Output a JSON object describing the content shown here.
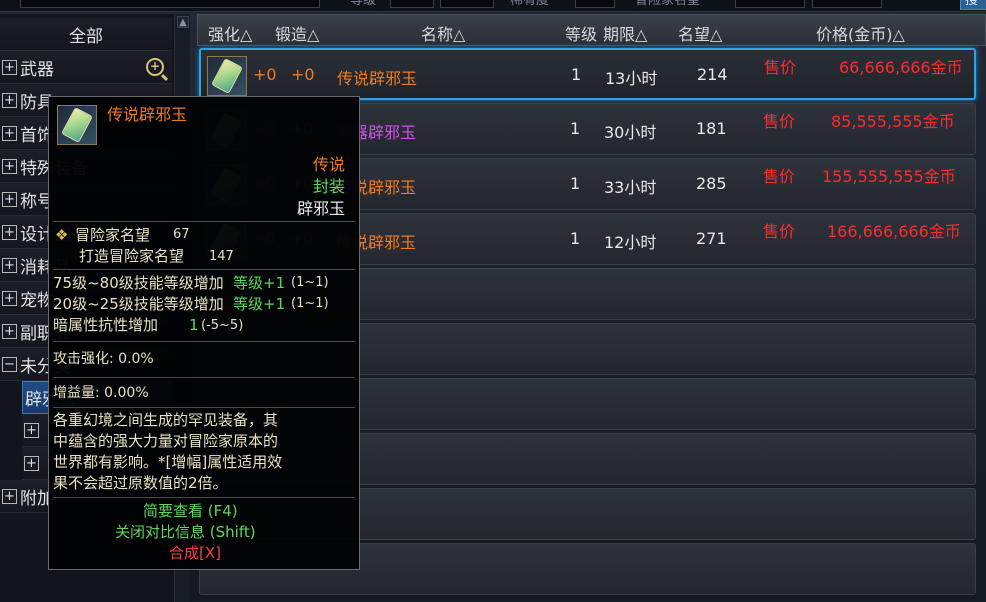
{
  "top_bar": {
    "level_label": "等级",
    "custom_label": "稀有度",
    "fame_label": "冒险家名望",
    "search_button": "搜"
  },
  "sidebar": {
    "all_label": "全部",
    "items": [
      {
        "label": "武器",
        "expand": "+"
      },
      {
        "label": "防具",
        "expand": "+"
      },
      {
        "label": "首饰",
        "expand": "+"
      },
      {
        "label": "特殊装备",
        "expand": "+"
      },
      {
        "label": "称号",
        "expand": "+"
      },
      {
        "label": "设计图",
        "expand": "+"
      },
      {
        "label": "消耗品",
        "expand": "+"
      },
      {
        "label": "宠物",
        "expand": "+"
      },
      {
        "label": "副职业",
        "expand": "+"
      },
      {
        "label": "未分类",
        "expand": "−"
      }
    ],
    "selected_sub": "辟邪玉",
    "sub_items": [
      {
        "label": "",
        "expand": "+"
      },
      {
        "label": "",
        "expand": "+"
      }
    ],
    "last_item": {
      "label": "附加",
      "expand": "+"
    }
  },
  "table": {
    "columns": [
      "强化△",
      "锻造△",
      "名称△",
      "等级",
      "期限△",
      "名望△",
      "价格(金币)△"
    ],
    "rows": [
      {
        "enhance": "+0",
        "forge": "+0",
        "name": "传说辟邪玉",
        "name_color": "#f07b1e",
        "level": "1",
        "duration": "13小时",
        "fame": "214",
        "sell_label": "售价",
        "price": "66,666,666金币"
      },
      {
        "enhance": "+0",
        "forge": "+0",
        "name": "神器辟邪玉",
        "name_color": "#d24ef0",
        "level": "1",
        "duration": "30小时",
        "fame": "181",
        "sell_label": "售价",
        "price": "85,555,555金币"
      },
      {
        "enhance": "+0",
        "forge": "+0",
        "name": "传说辟邪玉",
        "name_color": "#f07b1e",
        "level": "1",
        "duration": "33小时",
        "fame": "285",
        "sell_label": "售价",
        "price": "155,555,555金币"
      },
      {
        "enhance": "+0",
        "forge": "+0",
        "name": "传说辟邪玉",
        "name_color": "#f07b1e",
        "level": "1",
        "duration": "12小时",
        "fame": "271",
        "sell_label": "售价",
        "price": "166,666,666金币"
      }
    ],
    "empty_rows": 6
  },
  "tooltip": {
    "item_name": "传说辟邪玉",
    "rarity": "传说",
    "bind": "封装",
    "type": "辟邪玉",
    "fame_label": "冒险家名望",
    "fame_value": "67",
    "forge_fame_label": "打造冒险家名望",
    "forge_fame_value": "147",
    "stat1_main": "75级~80级技能等级增加",
    "stat1_bonus": "等级+1",
    "stat1_range": "(1~1)",
    "stat2_main": "20级~25级技能等级增加",
    "stat2_bonus": "等级+1",
    "stat2_range": "(1~1)",
    "stat3_main": "暗属性抗性增加",
    "stat3_bonus": "1",
    "stat3_range": "(-5~5)",
    "attack_enhance": "攻击强化: 0.0%",
    "buff_amount": "增益量: 0.00%",
    "desc_line1": "各重幻境之间生成的罕见装备，其",
    "desc_line2": "中蕴含的强大力量对冒险家原本的",
    "desc_line3": "世界都有影响。*[增幅]属性适用效",
    "desc_line4": "果不会超过原数值的2倍。",
    "action1": "简要查看 (F4)",
    "action2": "关闭对比信息 (Shift)",
    "action3": "合成[X]"
  },
  "colors": {
    "legendary": "#f07b1e",
    "epic": "#d24ef0",
    "price": "#ff2b2b",
    "selected_border": "#2ea3e6",
    "action_green": "#5fd65f",
    "action_red": "#ff4040"
  }
}
